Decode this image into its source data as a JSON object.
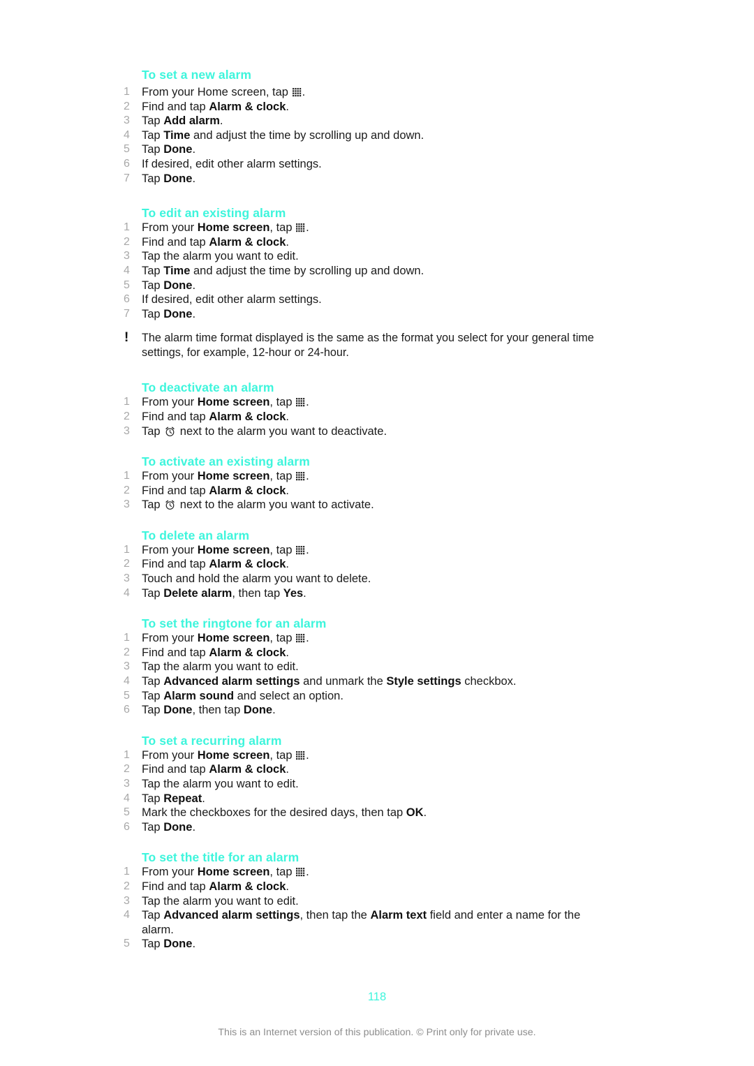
{
  "document": {
    "page_number": "118",
    "footer_note": "This is an Internet version of this publication. © Print only for private use.",
    "accent_color": "#3EF5DC",
    "number_color": "#A8A8A8",
    "text_color": "#1B1B1B"
  },
  "icons": {
    "app_drawer": "app-drawer-grid-icon",
    "alarm_clock": "alarm-clock-icon",
    "note": "exclamation-mark-icon"
  },
  "sections": [
    {
      "heading": "To set a new alarm",
      "steps": [
        {
          "html": "From your Home screen, tap <span class=\"icon-appdrawer\" data-name=\"app-drawer-grid-icon\" data-interactable=\"false\"></span>."
        },
        {
          "html": "Find and tap <b>Alarm &amp; clock</b>."
        },
        {
          "html": "Tap <b>Add alarm</b>."
        },
        {
          "html": "Tap <b>Time</b> and adjust the time by scrolling up and down."
        },
        {
          "html": "Tap <b>Done</b>."
        },
        {
          "html": "If desired, edit other alarm settings."
        },
        {
          "html": "Tap <b>Done</b>."
        }
      ]
    },
    {
      "heading": "To edit an existing alarm",
      "steps": [
        {
          "html": "From your <b>Home screen</b>, tap <span class=\"icon-appdrawer\" data-name=\"app-drawer-grid-icon\" data-interactable=\"false\"></span>."
        },
        {
          "html": "Find and tap <b>Alarm &amp; clock</b>."
        },
        {
          "html": "Tap the alarm you want to edit."
        },
        {
          "html": "Tap <b>Time</b> and adjust the time by scrolling up and down."
        },
        {
          "html": "Tap <b>Done</b>."
        },
        {
          "html": "If desired, edit other alarm settings."
        },
        {
          "html": "Tap <b>Done</b>."
        }
      ],
      "note": "The alarm time format displayed is the same as the format you select for your general time settings, for example, 12-hour or 24-hour."
    },
    {
      "heading": "To deactivate an alarm",
      "steps": [
        {
          "html": "From your <b>Home screen</b>, tap <span class=\"icon-appdrawer\" data-name=\"app-drawer-grid-icon\" data-interactable=\"false\"></span>."
        },
        {
          "html": "Find and tap <b>Alarm &amp; clock</b>."
        },
        {
          "html": "Tap <span class=\"icon-alarmclock\" data-name=\"alarm-clock-icon\" data-interactable=\"false\"></span> next to the alarm you want to deactivate."
        }
      ]
    },
    {
      "heading": "To activate an existing alarm",
      "steps": [
        {
          "html": "From your <b>Home screen</b>, tap <span class=\"icon-appdrawer\" data-name=\"app-drawer-grid-icon\" data-interactable=\"false\"></span>."
        },
        {
          "html": "Find and tap <b>Alarm &amp; clock</b>."
        },
        {
          "html": "Tap <span class=\"icon-alarmclock\" data-name=\"alarm-clock-icon\" data-interactable=\"false\"></span> next to the alarm you want to activate."
        }
      ]
    },
    {
      "heading": "To delete an alarm",
      "steps": [
        {
          "html": "From your <b>Home screen</b>, tap <span class=\"icon-appdrawer\" data-name=\"app-drawer-grid-icon\" data-interactable=\"false\"></span>."
        },
        {
          "html": "Find and tap <b>Alarm &amp; clock</b>."
        },
        {
          "html": "Touch and hold the alarm you want to delete."
        },
        {
          "html": "Tap <b>Delete alarm</b>, then tap <b>Yes</b>."
        }
      ]
    },
    {
      "heading": "To set the ringtone for an alarm",
      "steps": [
        {
          "html": "From your <b>Home screen</b>, tap <span class=\"icon-appdrawer\" data-name=\"app-drawer-grid-icon\" data-interactable=\"false\"></span>."
        },
        {
          "html": "Find and tap <b>Alarm &amp; clock</b>."
        },
        {
          "html": "Tap the alarm you want to edit."
        },
        {
          "html": "Tap <b>Advanced alarm settings</b> and unmark the <b>Style settings</b> checkbox."
        },
        {
          "html": "Tap <b>Alarm sound</b> and select an option."
        },
        {
          "html": "Tap <b>Done</b>, then tap <b>Done</b>."
        }
      ]
    },
    {
      "heading": "To set a recurring alarm",
      "steps": [
        {
          "html": "From your <b>Home screen</b>, tap <span class=\"icon-appdrawer\" data-name=\"app-drawer-grid-icon\" data-interactable=\"false\"></span>."
        },
        {
          "html": "Find and tap <b>Alarm &amp; clock</b>."
        },
        {
          "html": "Tap the alarm you want to edit."
        },
        {
          "html": "Tap <b>Repeat</b>."
        },
        {
          "html": "Mark the checkboxes for the desired days, then tap <b>OK</b>."
        },
        {
          "html": "Tap <b>Done</b>."
        }
      ]
    },
    {
      "heading": "To set the title for an alarm",
      "steps": [
        {
          "html": "From your <b>Home screen</b>, tap <span class=\"icon-appdrawer\" data-name=\"app-drawer-grid-icon\" data-interactable=\"false\"></span>."
        },
        {
          "html": "Find and tap <b>Alarm &amp; clock</b>."
        },
        {
          "html": "Tap the alarm you want to edit."
        },
        {
          "html": "Tap <b>Advanced alarm settings</b>, then tap the <b>Alarm text</b> field and enter a name for the alarm."
        },
        {
          "html": "Tap <b>Done</b>."
        }
      ]
    }
  ]
}
